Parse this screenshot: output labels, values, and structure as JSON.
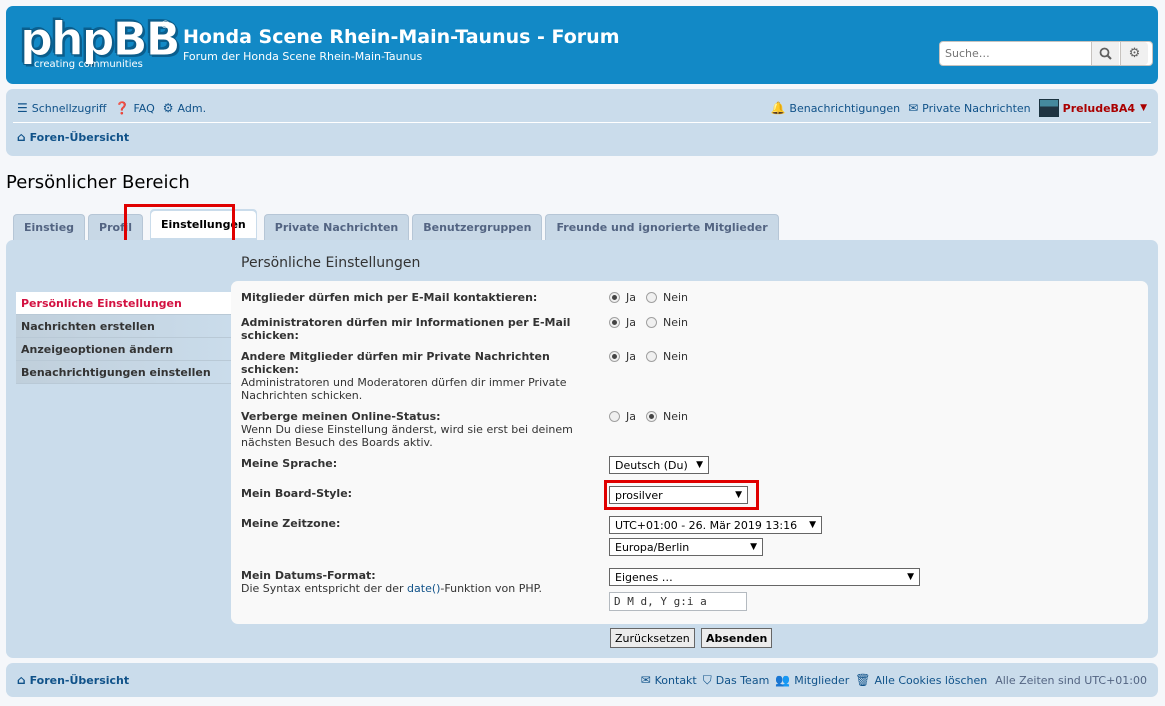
{
  "header": {
    "logo_text": "phpBB",
    "logo_reg": "®",
    "logo_tagline": "creating    communities",
    "site_title": "Honda Scene Rhein-Main-Taunus - Forum",
    "site_description": "Forum der Honda Scene Rhein-Main-Taunus",
    "search_placeholder": "Suche…",
    "search_icon": "search-icon",
    "advanced_search_icon": "gear-icon"
  },
  "navbar": {
    "quicklinks": "Schnellzugriff",
    "faq": "FAQ",
    "acp": "Adm.",
    "notifications": "Benachrichtigungen",
    "private_messages": "Private Nachrichten",
    "username": "PreludeBA4",
    "breadcrumb": "Foren-Übersicht"
  },
  "page_title": "Persönlicher Bereich",
  "tabs": [
    {
      "label": "Einstieg"
    },
    {
      "label": "Profil"
    },
    {
      "label": "Einstellungen"
    },
    {
      "label": "Private Nachrichten"
    },
    {
      "label": "Benutzergruppen"
    },
    {
      "label": "Freunde und ignorierte Mitglieder"
    }
  ],
  "side_menu": [
    {
      "label": "Persönliche Einstellungen"
    },
    {
      "label": "Nachrichten erstellen"
    },
    {
      "label": "Anzeigeoptionen ändern"
    },
    {
      "label": "Benachrichtigungen einstellen"
    }
  ],
  "content_title": "Persönliche Einstellungen",
  "settings": {
    "email": {
      "label": "Mitglieder dürfen mich per E-Mail kontaktieren:",
      "yes": "Ja",
      "no": "Nein",
      "selected": "yes"
    },
    "admin_email": {
      "label": "Administratoren dürfen mir Informationen per E-Mail schicken:",
      "yes": "Ja",
      "no": "Nein",
      "selected": "yes"
    },
    "pm": {
      "label": "Andere Mitglieder dürfen mir Private Nachrichten schicken:",
      "hint": "Administratoren und Moderatoren dürfen dir immer Private Nachrichten schicken.",
      "yes": "Ja",
      "no": "Nein",
      "selected": "yes"
    },
    "online": {
      "label": "Verberge meinen Online-Status:",
      "hint": "Wenn Du diese Einstellung änderst, wird sie erst bei deinem nächsten Besuch des Boards aktiv.",
      "yes": "Ja",
      "no": "Nein",
      "selected": "no"
    },
    "language": {
      "label": "Meine Sprache:",
      "value": "Deutsch (Du)"
    },
    "style": {
      "label": "Mein Board-Style:",
      "value": "prosilver"
    },
    "timezone": {
      "label": "Meine Zeitzone:",
      "value": "UTC+01:00 - 26. Mär 2019 13:16",
      "region": "Europa/Berlin"
    },
    "dateformat": {
      "label": "Mein Datums-Format:",
      "hint_pre": "Die Syntax entspricht der der ",
      "hint_link": "date()",
      "hint_post": "-Funktion von PHP.",
      "value": "Eigenes …",
      "custom": "D M d, Y g:i a"
    }
  },
  "buttons": {
    "reset": "Zurücksetzen",
    "submit": "Absenden"
  },
  "footer": {
    "breadcrumb": "Foren-Übersicht",
    "contact": "Kontakt",
    "team": "Das Team",
    "members": "Mitglieder",
    "cookies": "Alle Cookies löschen",
    "timezone": "Alle Zeiten sind UTC+01:00"
  },
  "colors": {
    "accent": "#105289",
    "header": "#1289c6",
    "panel": "#cadceb",
    "active_menu": "#d31141",
    "highlight": "#e00000",
    "username": "#aa0000"
  }
}
